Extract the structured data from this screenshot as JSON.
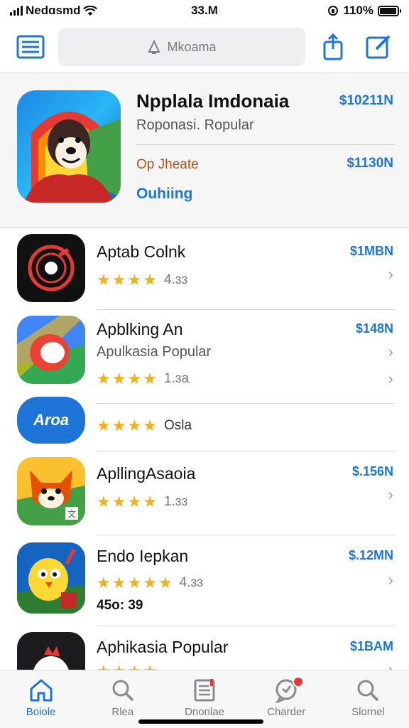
{
  "status": {
    "carrier": "Nedɑsmd",
    "time": "33.M",
    "battery": "110%",
    "battery_level": 0.95
  },
  "search": {
    "placeholder": "Mkoama"
  },
  "featured": {
    "title": "Npplala Imdonaia",
    "subtitle": "Roponasi. Ropular",
    "price_top": "$10211N",
    "update_label": "Op Jheate",
    "price_bottom": "$1130N",
    "link": "Ouhiing"
  },
  "apps": [
    {
      "title": "Aptab Colnk",
      "price": "$1MBN",
      "rating_text": "4.ɜɜ",
      "stars": 4
    },
    {
      "title": "Apblking An",
      "subtitle": "Apulkasia Popular",
      "price": "$148N",
      "rating_text": "1.ɜa",
      "stars": 4
    },
    {
      "rating_text": "Osla",
      "stars": 4,
      "icon_text": "Aroa"
    },
    {
      "title": "ApllingAsaoia",
      "price": "$.156N",
      "rating_text": "1.ɜɜ",
      "stars": 4
    },
    {
      "title": "Endo Iepkan",
      "price": "$.12MN",
      "rating_text": "4.ɜɜ",
      "stars": 5,
      "extra": "45o: 39"
    },
    {
      "title": "Aphikasia Popular",
      "price": "$1BAM",
      "stars": 4
    }
  ],
  "tabs": [
    {
      "label": "Boiole",
      "icon": "home-icon",
      "active": true
    },
    {
      "label": "Rlea",
      "icon": "search-icon",
      "active": false
    },
    {
      "label": "Dnonlae",
      "icon": "document-icon",
      "active": false
    },
    {
      "label": "Charder",
      "icon": "chat-icon",
      "active": false,
      "badge": true
    },
    {
      "label": "Slornel",
      "icon": "search-icon",
      "active": false
    }
  ],
  "colors": {
    "accent": "#1f74d8",
    "star": "#f2b01b",
    "update": "#b5511b",
    "badge": "#e53935"
  }
}
